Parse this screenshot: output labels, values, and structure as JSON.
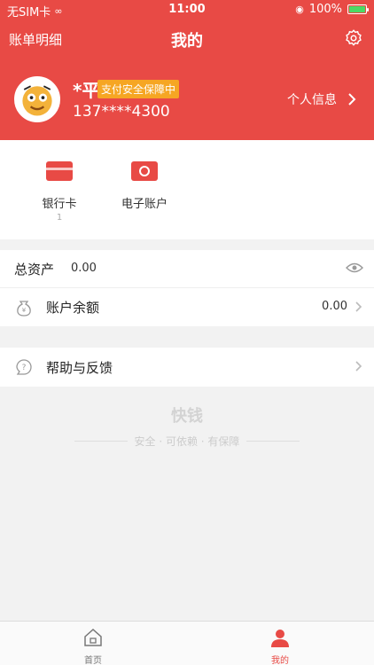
{
  "status": {
    "carrier": "无SIM卡",
    "time": "11:00",
    "battery": "100%"
  },
  "nav": {
    "left": "账单明细",
    "title": "我的"
  },
  "profile": {
    "name": "*平",
    "badge": "支付安全保障中",
    "phone": "137****4300",
    "info_link": "个人信息"
  },
  "quick": [
    {
      "label": "银行卡",
      "sub": "1"
    },
    {
      "label": "电子账户",
      "sub": ""
    }
  ],
  "assets": {
    "total_label": "总资产",
    "total_value": "0.00",
    "balance_label": "账户余额",
    "balance_value": "0.00"
  },
  "help": {
    "label": "帮助与反馈"
  },
  "watermark": {
    "logo": "快钱",
    "tagline": "安全 · 可依赖 · 有保障"
  },
  "tabs": [
    {
      "label": "首页"
    },
    {
      "label": "我的"
    }
  ],
  "colors": {
    "brand": "#e84a45",
    "badge": "#f6a623"
  }
}
